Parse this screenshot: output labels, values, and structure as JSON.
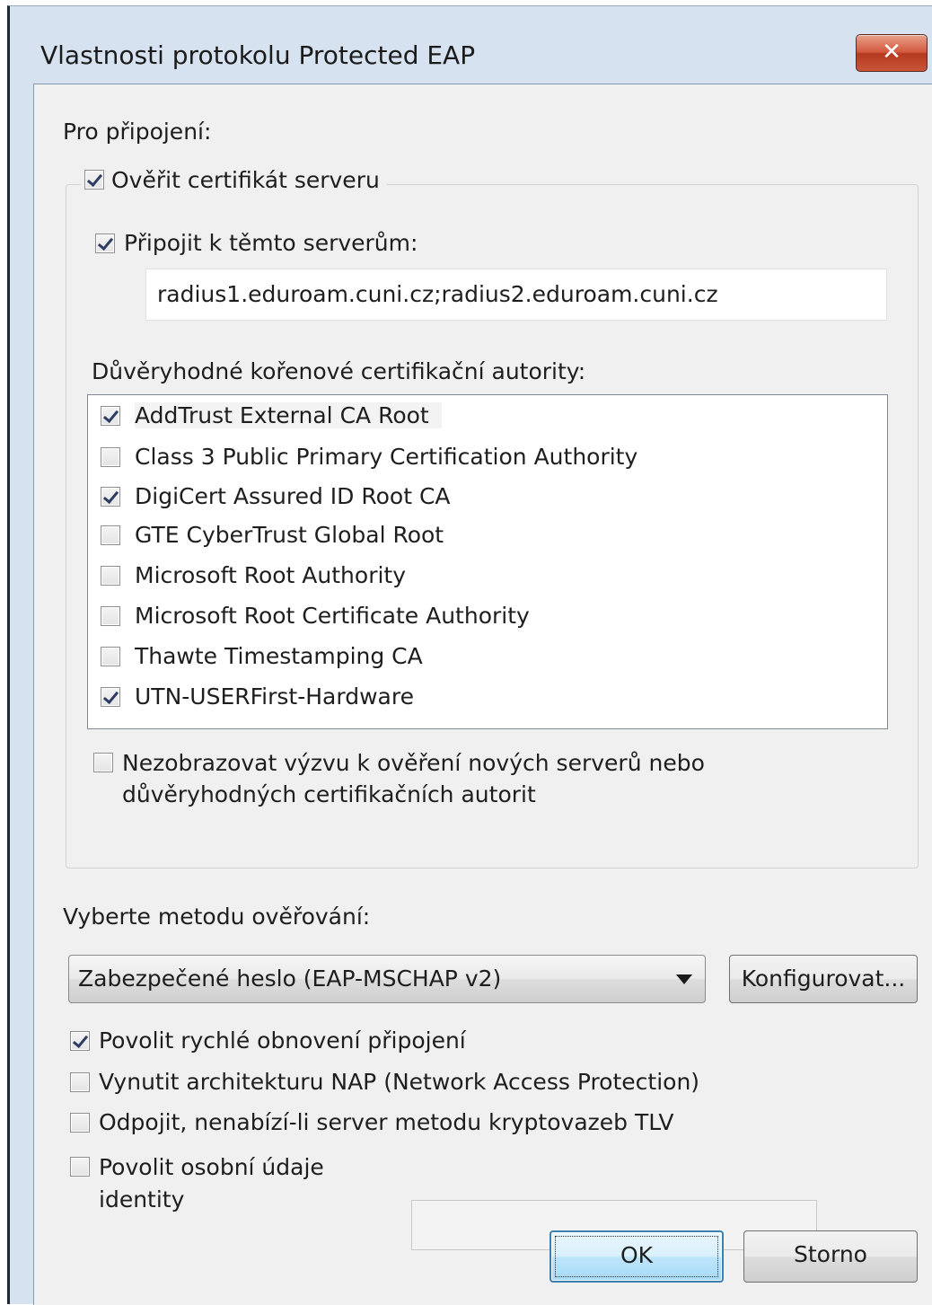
{
  "window": {
    "title": "Vlastnosti protokolu Protected EAP",
    "close_glyph": "✕"
  },
  "connection": {
    "heading": "Pro připojení:",
    "verify_cert": {
      "label": "Ověřit certifikát serveru",
      "checked": true
    },
    "connect_to_servers": {
      "label": "Připojit k těmto serverům:",
      "checked": true
    },
    "servers_value": "radius1.eduroam.cuni.cz;radius2.eduroam.cuni.cz",
    "trusted_ca_label": "Důvěryhodné kořenové certifikační autority:",
    "trusted_cas": [
      {
        "name": "AddTrust External CA Root",
        "checked": true,
        "selected": true
      },
      {
        "name": "Class 3 Public Primary Certification Authority",
        "checked": false
      },
      {
        "name": "DigiCert Assured ID Root CA",
        "checked": true
      },
      {
        "name": "GTE CyberTrust Global Root",
        "checked": false
      },
      {
        "name": "Microsoft Root Authority",
        "checked": false
      },
      {
        "name": "Microsoft Root Certificate Authority",
        "checked": false
      },
      {
        "name": "Thawte Timestamping CA",
        "checked": false
      },
      {
        "name": "UTN-USERFirst-Hardware",
        "checked": true
      }
    ],
    "no_prompt": {
      "line1": "Nezobrazovat výzvu k ověření nových serverů nebo",
      "line2": "důvěryhodných certifikačních autorit",
      "checked": false
    }
  },
  "auth": {
    "heading": "Vyberte metodu ověřování:",
    "method_selected": "Zabezpečené heslo (EAP-MSCHAP v2)",
    "configure_button": "Konfigurovat..."
  },
  "options": {
    "fast_reconnect": {
      "label": "Povolit rychlé obnovení připojení",
      "checked": true
    },
    "enforce_nap": {
      "label": "Vynutit architekturu NAP (Network Access Protection)",
      "checked": false
    },
    "disconnect_tlv": {
      "label": "Odpojit, nenabízí-li server metodu kryptovazeb TLV",
      "checked": false
    },
    "identity_privacy": {
      "line1": "Povolit osobní údaje",
      "line2": "identity",
      "checked": false,
      "value": ""
    }
  },
  "buttons": {
    "ok": "OK",
    "cancel": "Storno"
  },
  "colors": {
    "client_bg": "#f0f0f0",
    "frame": "#d6e2ef",
    "close_red": "#c8553a",
    "default_btn_border": "#3c7fb1"
  }
}
